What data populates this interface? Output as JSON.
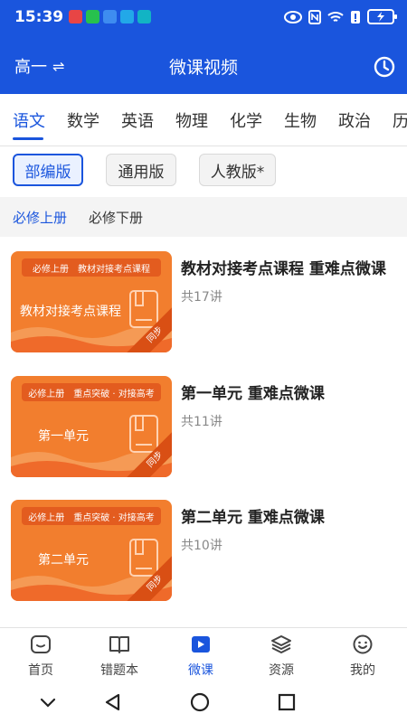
{
  "status_bar": {
    "time": "15:39"
  },
  "header": {
    "grade": "高一",
    "swap_glyph": "⇌",
    "title": "微课视频"
  },
  "subjects": [
    "语文",
    "数学",
    "英语",
    "物理",
    "化学",
    "生物",
    "政治",
    "历"
  ],
  "editions": [
    "部编版",
    "通用版",
    "人教版*"
  ],
  "volumes": [
    "必修上册",
    "必修下册"
  ],
  "courses": [
    {
      "tag1": "必修上册",
      "tag2": "教材对接考点课程",
      "thumb_title": "教材对接考点课程",
      "ribbon": "同步",
      "title": "教材对接考点课程 重难点微课",
      "count": "共17讲"
    },
    {
      "tag1": "必修上册",
      "tag2": "重点突破 · 对接高考",
      "thumb_title": "第一单元",
      "ribbon": "同步",
      "title": "第一单元 重难点微课",
      "count": "共11讲"
    },
    {
      "tag1": "必修上册",
      "tag2": "重点突破 · 对接高考",
      "thumb_title": "第二单元",
      "ribbon": "同步",
      "title": "第二单元 重难点微课",
      "count": "共10讲"
    }
  ],
  "bottom_nav": [
    "首页",
    "错题本",
    "微课",
    "资源",
    "我的"
  ],
  "colors": {
    "accent": "#1a55dd",
    "thumb": "#f27e2e"
  }
}
